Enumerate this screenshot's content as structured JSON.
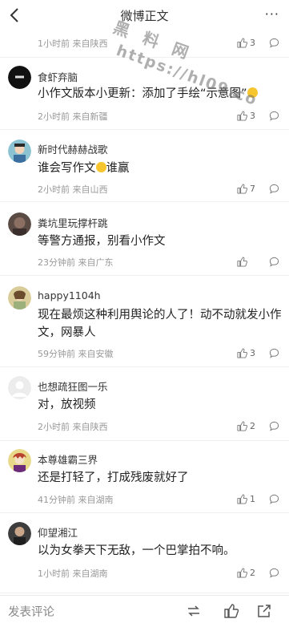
{
  "header": {
    "title": "微博正文",
    "more": "···"
  },
  "watermark": {
    "line1": "黑 料 网",
    "line2": "https://hl09.co"
  },
  "first_row": {
    "meta": "1小时前 来自陕西",
    "likes": "3"
  },
  "comments": [
    {
      "username": "食虾弃脑",
      "content": "小作文版本小更新：添加了手绘“示意图”",
      "meta": "2小时前 来自新疆",
      "likes": "3",
      "avatar_color": "#111111"
    },
    {
      "username": "新时代赫赫战歌",
      "content": "谁会写作文",
      "content_tail": "谁赢",
      "meta": "2小时前 来自山西",
      "likes": "7",
      "avatar_color": "#7fb8c8"
    },
    {
      "username": "粪坑里玩撑杆跳",
      "content": "等警方通报，别看小作文",
      "meta": "23分钟前 来自广东",
      "likes": "",
      "avatar_color": "#5a4a44"
    },
    {
      "username": "happy1104h",
      "content": "现在最烦这种利用舆论的人了！动不动就发小作文，网暴人",
      "meta": "59分钟前 来自安徽",
      "likes": "3",
      "avatar_color": "#c9b98a"
    },
    {
      "username": "也想疏狂图一乐",
      "content": "对，放视频",
      "meta": "2小时前 来自陕西",
      "likes": "2",
      "avatar_color": "#e6e6e6"
    },
    {
      "username": "本尊雄霸三界",
      "content": "还是打轻了，打成残废就好了",
      "meta": "41分钟前 来自湖南",
      "likes": "1",
      "avatar_color": "#d8c25a"
    },
    {
      "username": "仰望湘江",
      "content": "以为女拳天下无敌，一个巴掌拍不响。",
      "meta": "1小时前 来自湖南",
      "likes": "2",
      "avatar_color": "#3a3a3a"
    }
  ],
  "bottombar": {
    "placeholder": "发表评论"
  }
}
